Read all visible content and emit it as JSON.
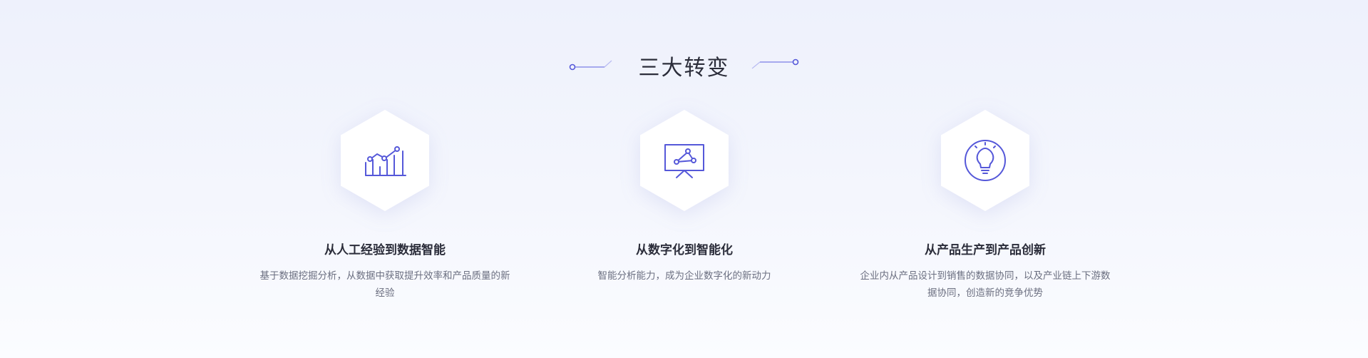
{
  "section": {
    "title": "三大转变",
    "accent_color": "#5558d9"
  },
  "cards": [
    {
      "icon": "growth-chart-icon",
      "title": "从人工经验到数据智能",
      "description": "基于数据挖掘分析，从数据中获取提升效率和产品质量的新经验"
    },
    {
      "icon": "presentation-board-icon",
      "title": "从数字化到智能化",
      "description": "智能分析能力，成为企业数字化的新动力"
    },
    {
      "icon": "lightbulb-icon",
      "title": "从产品生产到产品创新",
      "description": "企业内从产品设计到销售的数据协同，以及产业链上下游数据协同，创造新的竞争优势"
    }
  ]
}
